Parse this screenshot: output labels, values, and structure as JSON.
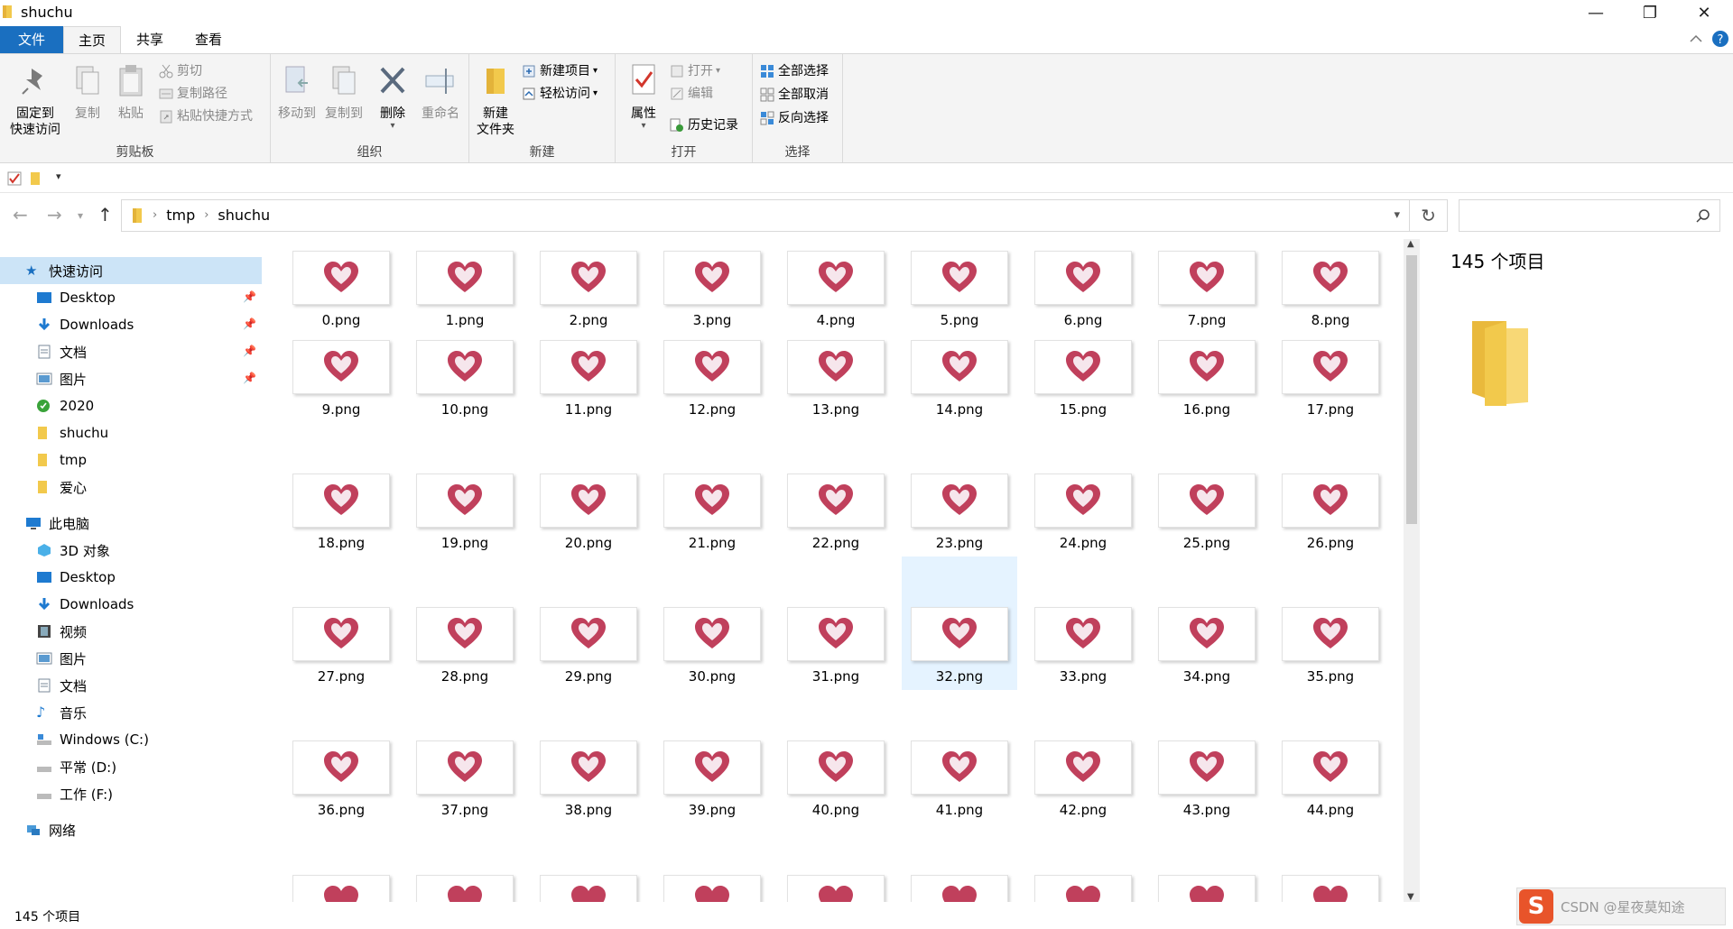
{
  "window": {
    "title": "shuchu",
    "minimize_glyph": "—",
    "maximize_glyph": "❐",
    "close_glyph": "✕"
  },
  "tabs": {
    "file": "文件",
    "home": "主页",
    "share": "共享",
    "view": "查看"
  },
  "ribbon": {
    "clipboard": {
      "group": "剪贴板",
      "pin_line1": "固定到",
      "pin_line2": "快速访问",
      "copy": "复制",
      "paste": "粘贴",
      "cut": "剪切",
      "copy_path": "复制路径",
      "paste_shortcut": "粘贴快捷方式"
    },
    "organize": {
      "group": "组织",
      "move_to": "移动到",
      "copy_to": "复制到",
      "delete": "删除",
      "rename": "重命名"
    },
    "new": {
      "group": "新建",
      "new_folder_line1": "新建",
      "new_folder_line2": "文件夹",
      "new_item": "新建项目",
      "easy_access": "轻松访问"
    },
    "open": {
      "group": "打开",
      "properties": "属性",
      "open": "打开",
      "edit": "编辑",
      "history": "历史记录"
    },
    "select": {
      "group": "选择",
      "select_all": "全部选择",
      "select_none": "全部取消",
      "invert": "反向选择"
    }
  },
  "address": {
    "crumbs": [
      "tmp",
      "shuchu"
    ]
  },
  "nav": {
    "quick_access": "快速访问",
    "quick_items": [
      "Desktop",
      "Downloads",
      "文档",
      "图片",
      "2020",
      "shuchu",
      "tmp",
      "爱心"
    ],
    "this_pc": "此电脑",
    "pc_items": [
      "3D 对象",
      "Desktop",
      "Downloads",
      "视频",
      "图片",
      "文档",
      "音乐",
      "Windows (C:)",
      "平常 (D:)",
      "工作 (F:)"
    ],
    "network": "网络"
  },
  "files": [
    "0.png",
    "1.png",
    "2.png",
    "3.png",
    "4.png",
    "5.png",
    "6.png",
    "7.png",
    "8.png",
    "9.png",
    "10.png",
    "11.png",
    "12.png",
    "13.png",
    "14.png",
    "15.png",
    "16.png",
    "17.png",
    "18.png",
    "19.png",
    "20.png",
    "21.png",
    "22.png",
    "23.png",
    "24.png",
    "25.png",
    "26.png",
    "27.png",
    "28.png",
    "29.png",
    "30.png",
    "31.png",
    "32.png",
    "33.png",
    "34.png",
    "35.png",
    "36.png",
    "37.png",
    "38.png",
    "39.png",
    "40.png",
    "41.png",
    "42.png",
    "43.png",
    "44.png"
  ],
  "selected_file": "32.png",
  "preview": {
    "count": "145 个项目"
  },
  "status": {
    "count": "145 个项目"
  },
  "watermark": "CSDN @星夜莫知途",
  "colors": {
    "accent": "#1a6fc0",
    "selection": "#cce4f7",
    "heart": "#c0405c"
  }
}
